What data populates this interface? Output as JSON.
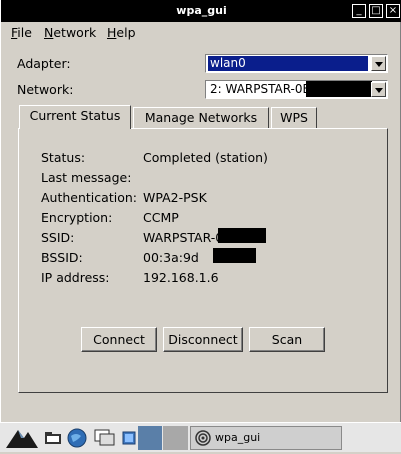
{
  "window": {
    "title": "wpa_gui"
  },
  "menu": [
    {
      "mnemonic": "F",
      "rest": "ile"
    },
    {
      "mnemonic": "N",
      "rest": "etwork"
    },
    {
      "mnemonic": "H",
      "rest": "elp"
    }
  ],
  "adapter": {
    "label": "Adapter:",
    "value": "wlan0"
  },
  "network": {
    "label": "Network:",
    "value": "2: WARPSTAR-0E"
  },
  "tabs": [
    "Current Status",
    "Manage Networks",
    "WPS"
  ],
  "status": {
    "rows": [
      {
        "label": "Status:",
        "value": "Completed (station)"
      },
      {
        "label": "Last message:",
        "value": ""
      },
      {
        "label": "Authentication:",
        "value": "WPA2-PSK"
      },
      {
        "label": "Encryption:",
        "value": "CCMP"
      },
      {
        "label": "SSID:",
        "value": "WARPSTAR-0"
      },
      {
        "label": "BSSID:",
        "value": "00:3a:9d"
      },
      {
        "label": "IP address:",
        "value": "192.168.1.6"
      }
    ]
  },
  "buttons": {
    "connect": "Connect",
    "disconnect": "Disconnect",
    "scan": "Scan"
  },
  "taskbar": {
    "task_label": "wpa_gui"
  },
  "colors": {
    "selection": "#0a1e8c",
    "titlebar": "#000000"
  }
}
